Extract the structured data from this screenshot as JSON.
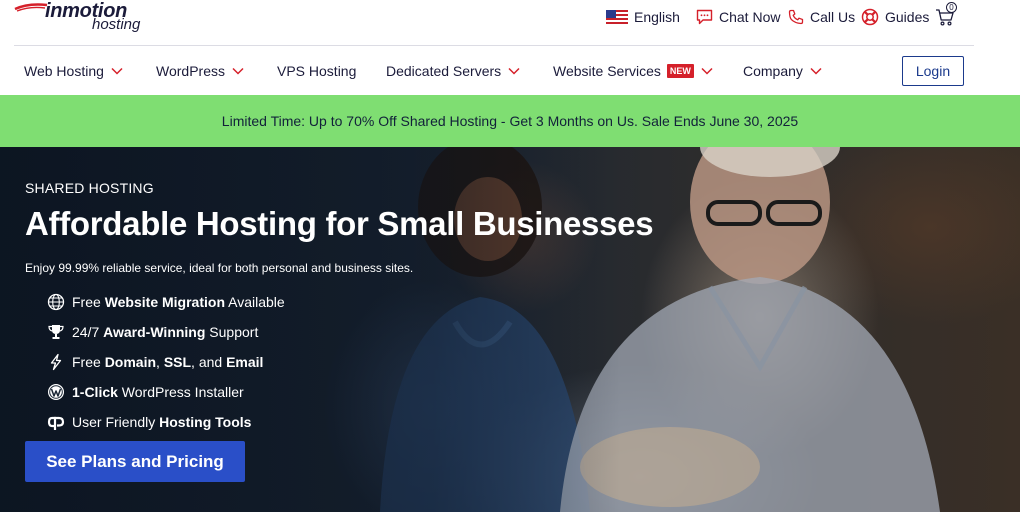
{
  "brand": {
    "name": "inmotion",
    "tagline": "hosting"
  },
  "utility": {
    "language": "English",
    "chat": "Chat Now",
    "call": "Call Us",
    "guides": "Guides",
    "cart_count": "0"
  },
  "nav": {
    "items": [
      {
        "label": "Web Hosting"
      },
      {
        "label": "WordPress"
      },
      {
        "label": "VPS Hosting"
      },
      {
        "label": "Dedicated Servers"
      },
      {
        "label": "Website Services",
        "badge": "NEW"
      },
      {
        "label": "Company"
      }
    ],
    "login": "Login"
  },
  "promo": {
    "text": "Limited Time: Up to 70% Off Shared Hosting - Get 3 Months on Us. Sale Ends June 30, 2025"
  },
  "hero": {
    "eyebrow": "SHARED HOSTING",
    "title": "Affordable Hosting for Small Businesses",
    "subtitle": "Enjoy 99.99% reliable service, ideal for both personal and business sites.",
    "features": [
      {
        "icon": "globe-icon",
        "pre": "Free ",
        "bold": "Website Migration",
        "post": " Available"
      },
      {
        "icon": "trophy-icon",
        "pre": "24/7 ",
        "bold": "Award-Winning",
        "post": " Support"
      },
      {
        "icon": "lightning-icon",
        "pre": "Free ",
        "bold": "Domain",
        "mid": ", ",
        "bold2": "SSL",
        "mid2": ", and ",
        "bold3": "Email"
      },
      {
        "icon": "wordpress-icon",
        "bold": "1-Click",
        "post": " WordPress Installer"
      },
      {
        "icon": "cpanel-icon",
        "pre": "User Friendly ",
        "bold": "Hosting Tools"
      }
    ],
    "cta": "See Plans and Pricing"
  },
  "colors": {
    "navy": "#1b1b3a",
    "promo_green": "#7fde72",
    "cta_blue": "#2a4fc8",
    "badge_red": "#d5202a",
    "login_blue": "#1b3a8c"
  }
}
